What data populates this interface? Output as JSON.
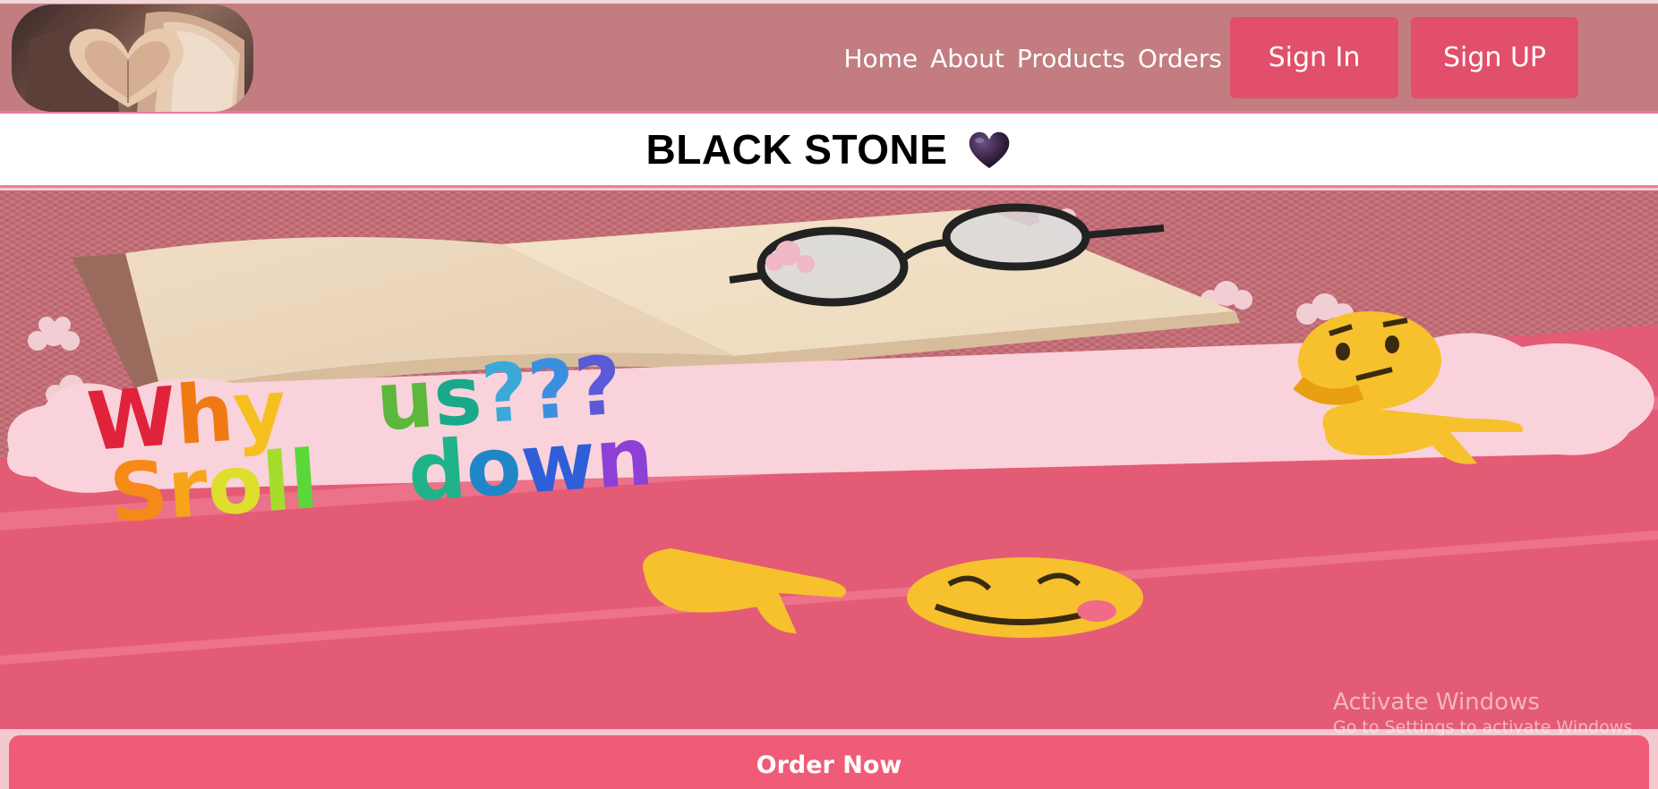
{
  "header": {
    "logo_name": "book-heart-logo",
    "nav": [
      {
        "label": "Home"
      },
      {
        "label": "About"
      },
      {
        "label": "Products"
      },
      {
        "label": "Orders"
      }
    ],
    "signin_label": "Sign In",
    "signup_label": "Sign UP"
  },
  "title": {
    "text": "BLACK STONE",
    "heart_icon": "black-heart-icon"
  },
  "hero": {
    "line1": "Why us???",
    "line2": "Sroll down"
  },
  "watermark": {
    "line1": "Activate Windows",
    "line2": "Go to Settings to activate Windows."
  },
  "order": {
    "label": "Order Now"
  },
  "colors": {
    "header_bg": "#c37d80",
    "button_bg": "#e14f6b",
    "accent_line": "#f27a97",
    "order_bg": "#f05b78",
    "hero_bg": "#c66a74"
  }
}
